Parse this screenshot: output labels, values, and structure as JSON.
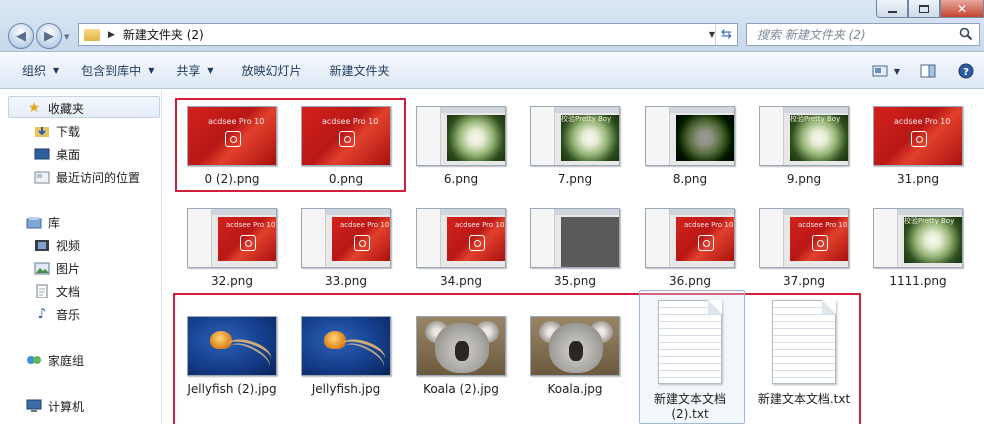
{
  "window": {
    "title": "新建文件夹 (2)"
  },
  "address": {
    "path": "新建文件夹 (2)"
  },
  "search": {
    "placeholder": "搜索 新建文件夹 (2)"
  },
  "toolbar": {
    "organize": "组织",
    "include_library": "包含到库中",
    "share": "共享",
    "slideshow": "放映幻灯片",
    "new_folder": "新建文件夹"
  },
  "sidebar": {
    "favorites": "收藏夹",
    "downloads": "下载",
    "desktop": "桌面",
    "recent": "最近访问的位置",
    "libraries": "库",
    "videos": "视频",
    "pictures": "图片",
    "documents": "文档",
    "music": "音乐",
    "homegroup": "家庭组",
    "computer": "计算机"
  },
  "files": [
    {
      "name": "0 (2).png",
      "kind": "acdsee"
    },
    {
      "name": "0.png",
      "kind": "acdsee"
    },
    {
      "name": "6.png",
      "kind": "shot-flower"
    },
    {
      "name": "7.png",
      "kind": "shot-flower-title"
    },
    {
      "name": "8.png",
      "kind": "shot-flower-dark"
    },
    {
      "name": "9.png",
      "kind": "shot-flower-title"
    },
    {
      "name": "31.png",
      "kind": "acdsee"
    },
    {
      "name": "32.png",
      "kind": "shot-acdsee"
    },
    {
      "name": "33.png",
      "kind": "shot-acdsee"
    },
    {
      "name": "34.png",
      "kind": "shot-acdsee"
    },
    {
      "name": "35.png",
      "kind": "shot-gray"
    },
    {
      "name": "36.png",
      "kind": "shot-acdsee"
    },
    {
      "name": "37.png",
      "kind": "shot-acdsee"
    },
    {
      "name": "1111.png",
      "kind": "shot-flower-title"
    },
    {
      "name": "Jellyfish (2).jpg",
      "kind": "jelly"
    },
    {
      "name": "Jellyfish.jpg",
      "kind": "jelly"
    },
    {
      "name": "Koala (2).jpg",
      "kind": "koala"
    },
    {
      "name": "Koala.jpg",
      "kind": "koala"
    },
    {
      "name": "新建文本文档 (2).txt",
      "kind": "txt"
    },
    {
      "name": "新建文本文档.txt",
      "kind": "txt"
    }
  ],
  "thumb_text": {
    "acdsee": "acdsee Pro 10",
    "flower_title": "校验Pretty   Boy"
  },
  "colors": {
    "highlight_box": "#d21f3a",
    "accent": "#1e395b"
  }
}
